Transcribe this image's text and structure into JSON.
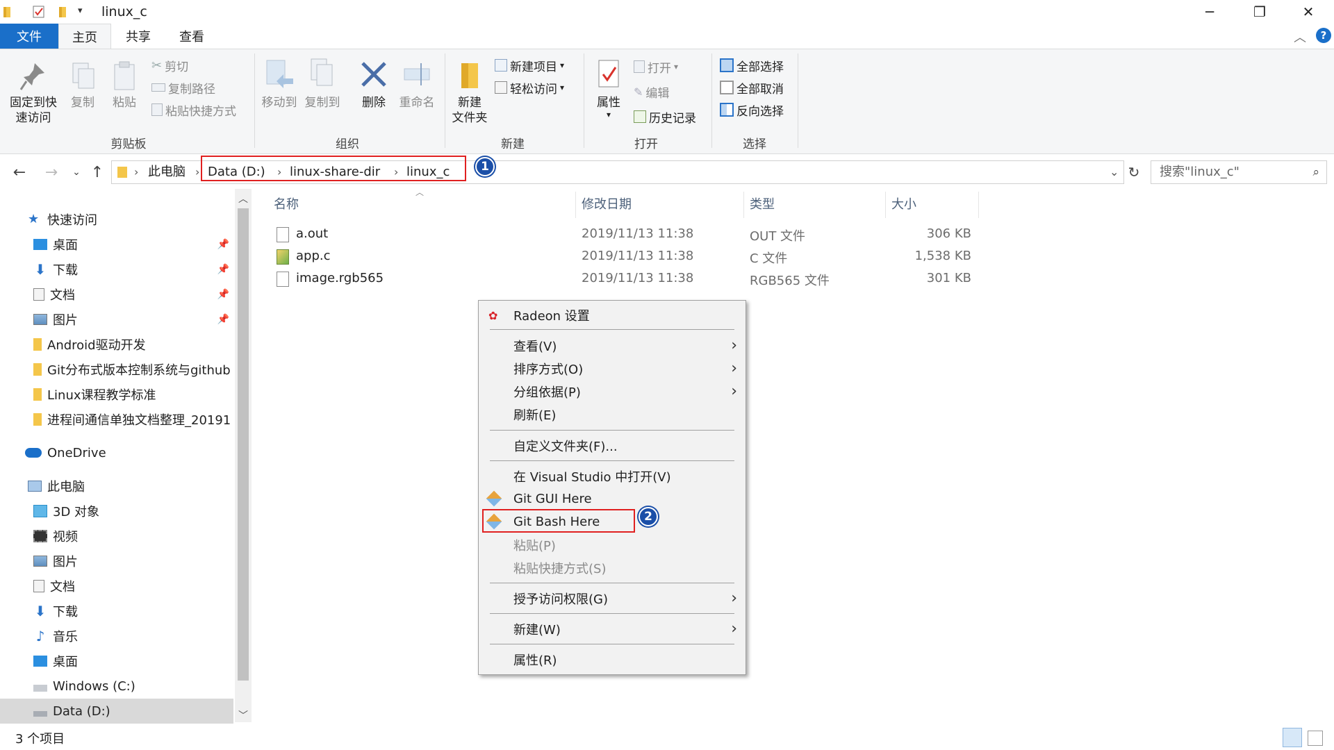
{
  "window": {
    "title": "linux_c",
    "controls": {
      "minimize": "─",
      "maximize": "❐",
      "close": "✕"
    }
  },
  "ribbon_tabs": [
    "文件",
    "主页",
    "共享",
    "查看"
  ],
  "ribbon": {
    "clipboard": {
      "label": "剪贴板",
      "pin": "固定到快\n速访问",
      "copy": "复制",
      "paste": "粘贴",
      "cut": "剪切",
      "copy_path": "复制路径",
      "paste_shortcut": "粘贴快捷方式"
    },
    "organize": {
      "label": "组织",
      "move_to": "移动到",
      "copy_to": "复制到",
      "delete": "删除",
      "rename": "重命名"
    },
    "new": {
      "label": "新建",
      "new_folder": "新建\n文件夹",
      "new_item": "新建项目",
      "easy_access": "轻松访问"
    },
    "open": {
      "label": "打开",
      "properties": "属性",
      "open": "打开",
      "edit": "编辑",
      "history": "历史记录"
    },
    "select": {
      "label": "选择",
      "select_all": "全部选择",
      "select_none": "全部取消",
      "invert": "反向选择"
    }
  },
  "address": {
    "crumbs": [
      "此电脑",
      "Data (D:)",
      "linux-share-dir",
      "linux_c"
    ],
    "search_placeholder": "搜索\"linux_c\""
  },
  "annotations": {
    "badge1": "1",
    "badge2": "2"
  },
  "nav": {
    "quick_access": "快速访问",
    "quick_items": [
      "桌面",
      "下载",
      "文档",
      "图片",
      "Android驱动开发",
      "Git分布式版本控制系统与github",
      "Linux课程教学标准",
      "进程间通信单独文档整理_20191"
    ],
    "onedrive": "OneDrive",
    "this_pc": "此电脑",
    "pc_items": [
      "3D 对象",
      "视频",
      "图片",
      "文档",
      "下载",
      "音乐",
      "桌面",
      "Windows (C:)",
      "Data (D:)"
    ]
  },
  "columns": {
    "name": "名称",
    "modified": "修改日期",
    "type": "类型",
    "size": "大小"
  },
  "files": [
    {
      "name": "a.out",
      "modified": "2019/11/13 11:38",
      "type": "OUT 文件",
      "size": "306 KB"
    },
    {
      "name": "app.c",
      "modified": "2019/11/13 11:38",
      "type": "C 文件",
      "size": "1,538 KB"
    },
    {
      "name": "image.rgb565",
      "modified": "2019/11/13 11:38",
      "type": "RGB565 文件",
      "size": "301 KB"
    }
  ],
  "context_menu": {
    "radeon": "Radeon 设置",
    "view": "查看(V)",
    "sort": "排序方式(O)",
    "group": "分组依据(P)",
    "refresh": "刷新(E)",
    "customize": "自定义文件夹(F)...",
    "open_vs": "在 Visual Studio 中打开(V)",
    "git_gui": "Git GUI Here",
    "git_bash": "Git Bash Here",
    "paste": "粘贴(P)",
    "paste_shortcut": "粘贴快捷方式(S)",
    "grant_access": "授予访问权限(G)",
    "new": "新建(W)",
    "properties": "属性(R)"
  },
  "status": {
    "count": "3 个项目"
  },
  "colors": {
    "accent": "#1a6fc9",
    "annotation_red": "#e02020",
    "badge_blue": "#1b4fa8",
    "folder": "#f4c64a"
  }
}
